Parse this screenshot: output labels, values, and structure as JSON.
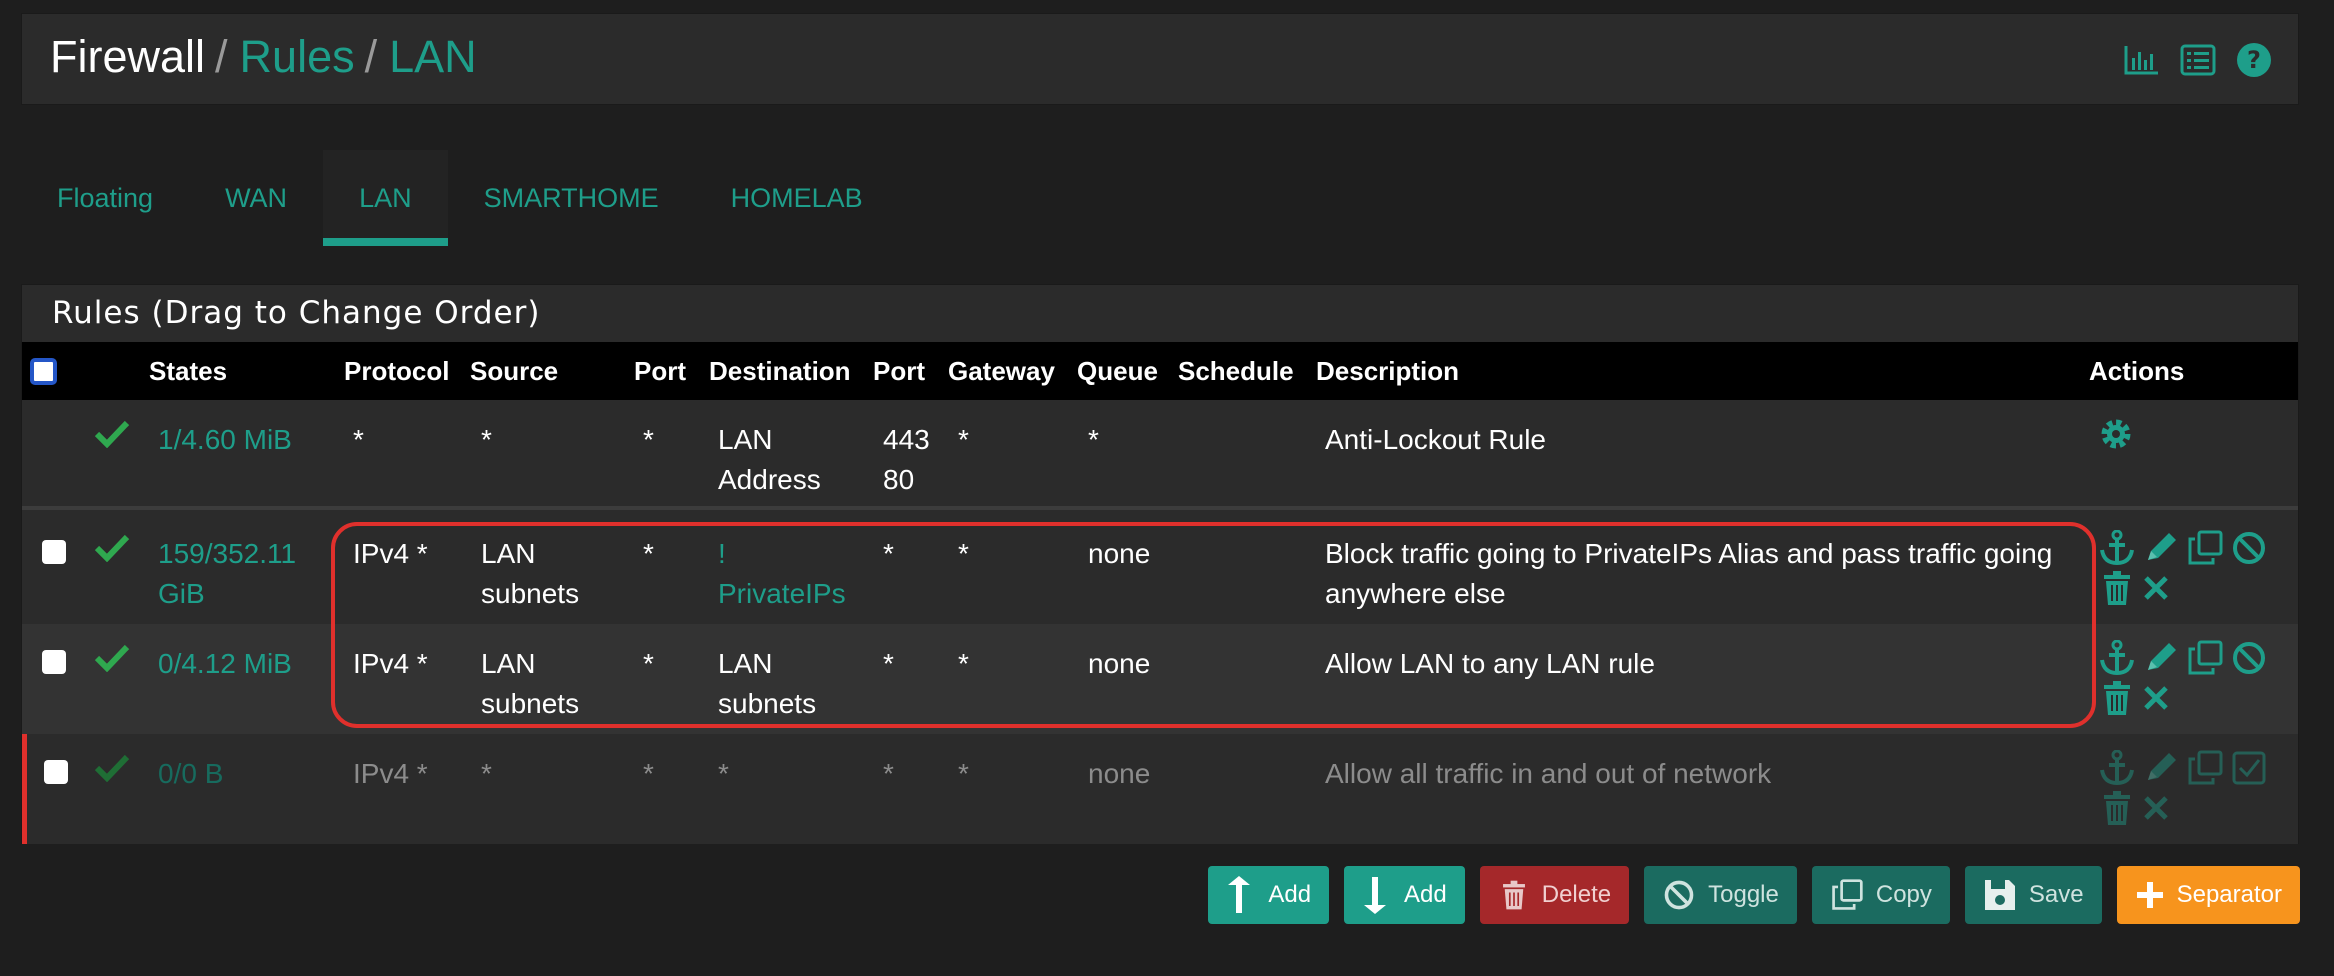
{
  "breadcrumb": {
    "root": "Firewall",
    "sep1": "/",
    "level1": "Rules",
    "sep2": "/",
    "level2": "LAN"
  },
  "header_icons": [
    "chart-icon",
    "list-icon",
    "help-icon"
  ],
  "tabs": [
    {
      "label": "Floating",
      "active": false
    },
    {
      "label": "WAN",
      "active": false
    },
    {
      "label": "LAN",
      "active": true
    },
    {
      "label": "SMARTHOME",
      "active": false
    },
    {
      "label": "HOMELAB",
      "active": false
    }
  ],
  "panel": {
    "title": "Rules (Drag to Change Order)"
  },
  "columns": {
    "states": "States",
    "protocol": "Protocol",
    "source": "Source",
    "port": "Port",
    "destination": "Destination",
    "dport": "Port",
    "gateway": "Gateway",
    "queue": "Queue",
    "schedule": "Schedule",
    "description": "Description",
    "actions": "Actions"
  },
  "rules": [
    {
      "states": "1/4.60 MiB",
      "protocol": "*",
      "source": "*",
      "port": "*",
      "destination": [
        "LAN",
        "Address"
      ],
      "dport": [
        "443",
        "80"
      ],
      "gateway": "*",
      "queue": "*",
      "schedule": "",
      "description": [
        "Anti-Lockout Rule"
      ],
      "actions": [
        "gear-icon"
      ]
    },
    {
      "states": [
        "159/352.11",
        "GiB"
      ],
      "protocol": "IPv4 *",
      "source": [
        "LAN",
        "subnets"
      ],
      "port": "*",
      "destination": [
        "!",
        "PrivateIPs"
      ],
      "dport": "*",
      "gateway": "*",
      "queue": "none",
      "schedule": "",
      "description": [
        "Block traffic going to PrivateIPs Alias and pass traffic going",
        "anywhere else"
      ],
      "actions": [
        "anchor-icon",
        "pencil-icon",
        "copy-icon",
        "disable-icon",
        "trash-icon",
        "x-icon"
      ]
    },
    {
      "states": "0/4.12 MiB",
      "protocol": "IPv4 *",
      "source": [
        "LAN",
        "subnets"
      ],
      "port": "*",
      "destination": [
        "LAN",
        "subnets"
      ],
      "dport": "*",
      "gateway": "*",
      "queue": "none",
      "schedule": "",
      "description": [
        "Allow LAN to any LAN rule"
      ],
      "actions": [
        "anchor-icon",
        "pencil-icon",
        "copy-icon",
        "disable-icon",
        "trash-icon",
        "x-icon"
      ]
    },
    {
      "states": "0/0 B",
      "protocol": "IPv4 *",
      "source": "*",
      "port": "*",
      "destination": "*",
      "dport": "*",
      "gateway": "*",
      "queue": "none",
      "schedule": "",
      "description": [
        "Allow all traffic in and out of network"
      ],
      "actions": [
        "anchor-icon",
        "pencil-icon",
        "copy-icon",
        "enable-icon",
        "trash-icon",
        "x-icon"
      ],
      "disabled": true
    }
  ],
  "buttons": {
    "add_top": "Add",
    "add_bottom": "Add",
    "delete": "Delete",
    "toggle": "Toggle",
    "copy": "Copy",
    "save": "Save",
    "separator": "Separator"
  },
  "colors": {
    "accent": "#1e9e8a",
    "danger": "#e0302c",
    "warning": "#f7941d",
    "background": "#1e1e1e",
    "panel": "#2b2b2b"
  }
}
